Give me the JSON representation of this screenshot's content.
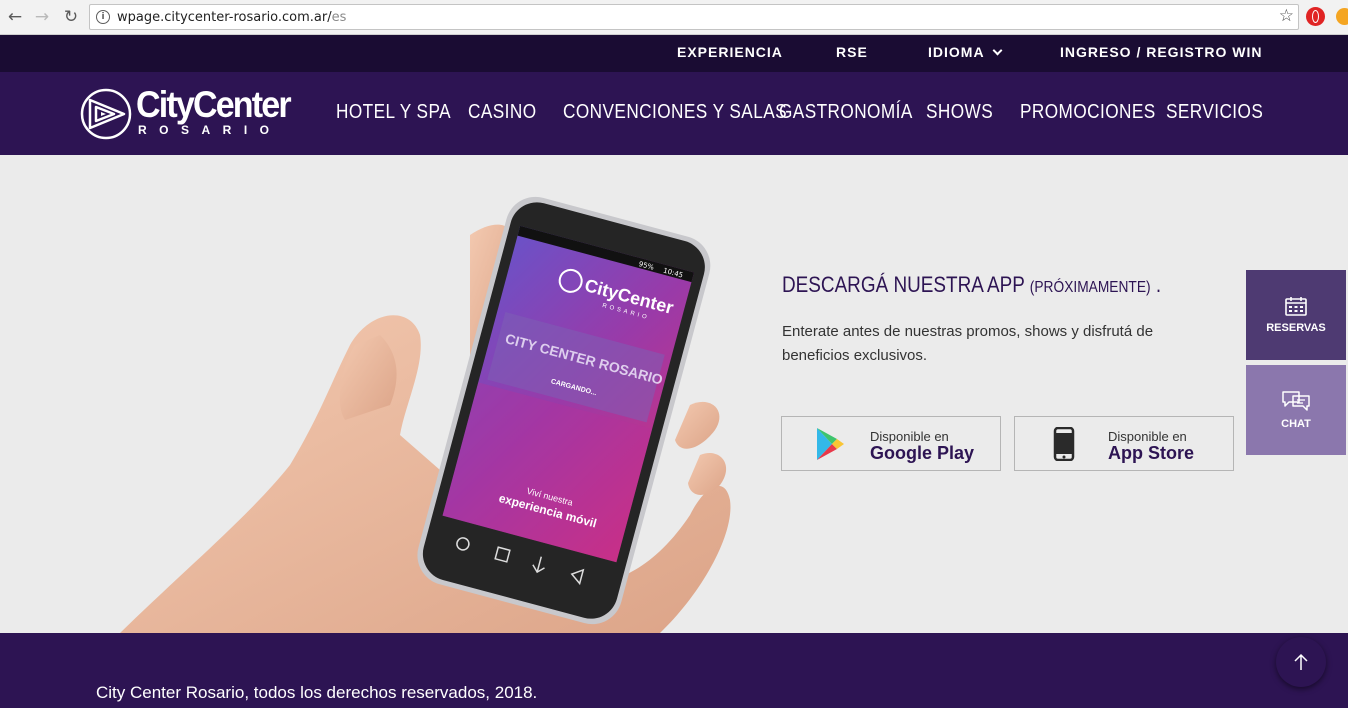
{
  "browser": {
    "url_host": "wpage.citycenter-rosario.com.ar/",
    "url_path": "es",
    "back_icon": "←",
    "forward_icon": "→",
    "reload_icon": "↻",
    "info_icon": "i",
    "star_icon": "☆"
  },
  "topbar": {
    "items": [
      "EXPERIENCIA",
      "RSE",
      "IDIOMA",
      "INGRESO / REGISTRO WIN"
    ]
  },
  "logo": {
    "name": "CityCenter",
    "sub": "ROSARIO"
  },
  "mainnav": {
    "items": [
      "HOTEL Y SPA",
      "CASINO",
      "CONVENCIONES Y SALAS",
      "GASTRONOMÍA",
      "SHOWS",
      "PROMOCIONES",
      "SERVICIOS"
    ]
  },
  "phone_screen": {
    "brand": "CityCenter",
    "brand_sub": "ROSARIO",
    "building_sign": "CITY CENTER ROSARIO",
    "loading": "CARGANDO...",
    "tagline_1": "Viví nuestra",
    "tagline_2": "experiencia móvil",
    "status_time": "10:45",
    "status_battery": "95%"
  },
  "app_section": {
    "title_main": "DESCARGÁ NUESTRA APP",
    "title_small": "(PRÓXIMAMENTE)",
    "title_end": ".",
    "description": "Enterate antes de nuestras promos, shows y disfrutá de beneficios exclusivos.",
    "google_play": {
      "small": "Disponible en",
      "big": "Google Play"
    },
    "app_store": {
      "small": "Disponible en",
      "big": "App Store"
    }
  },
  "side_widgets": {
    "reservas": {
      "label": "RESERVAS",
      "icon": "calendar-icon"
    },
    "chat": {
      "label": "CHAT",
      "icon": "chat-bubbles-icon"
    }
  },
  "footer": {
    "text": "City Center Rosario, todos los derechos reservados, 2018."
  },
  "colors": {
    "topbar": "#1a0c33",
    "header": "#2d1453",
    "reservas_bg": "#4e3a72",
    "chat_bg": "#8b77ad",
    "hero_bg": "#ebebeb"
  }
}
